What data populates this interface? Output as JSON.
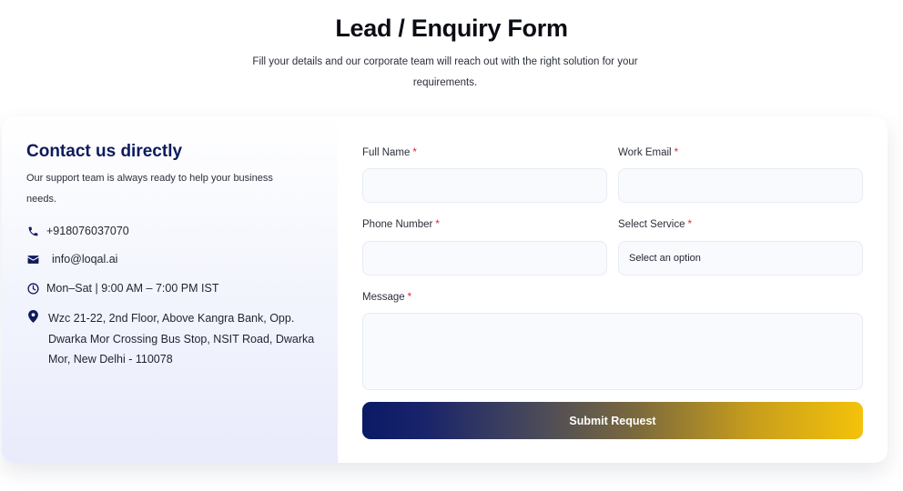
{
  "header": {
    "title": "Lead / Enquiry Form",
    "subtitle": "Fill your details and our corporate team will reach out with the right solution for your requirements."
  },
  "contact": {
    "title": "Contact us directly",
    "description": "Our support team is always ready to help your business needs.",
    "phone": "+918076037070",
    "email": "info@loqal.ai",
    "hours": "Mon–Sat | 9:00 AM – 7:00 PM IST",
    "address": "Wzc 21-22, 2nd Floor, Above Kangra Bank, Opp. Dwarka Mor Crossing Bus Stop, NSIT Road, Dwarka Mor, New Delhi - 110078",
    "icons": [
      "phone-icon",
      "mail-icon",
      "clock-icon",
      "location-pin-icon"
    ]
  },
  "form": {
    "full_name": {
      "label": "Full Name",
      "required_mark": "*",
      "value": ""
    },
    "work_email": {
      "label": "Work Email",
      "required_mark": "*",
      "value": ""
    },
    "phone_number": {
      "label": "Phone Number",
      "required_mark": "*",
      "value": ""
    },
    "service": {
      "label": "Select Service",
      "required_mark": "*",
      "selected": "Select an option"
    },
    "message": {
      "label": "Message",
      "required_mark": "*",
      "value": ""
    },
    "submit_label": "Submit Request"
  },
  "colors": {
    "brand_navy": "#0e1a5c",
    "brand_gold": "#f4c20a",
    "required_red": "#e0282e"
  }
}
